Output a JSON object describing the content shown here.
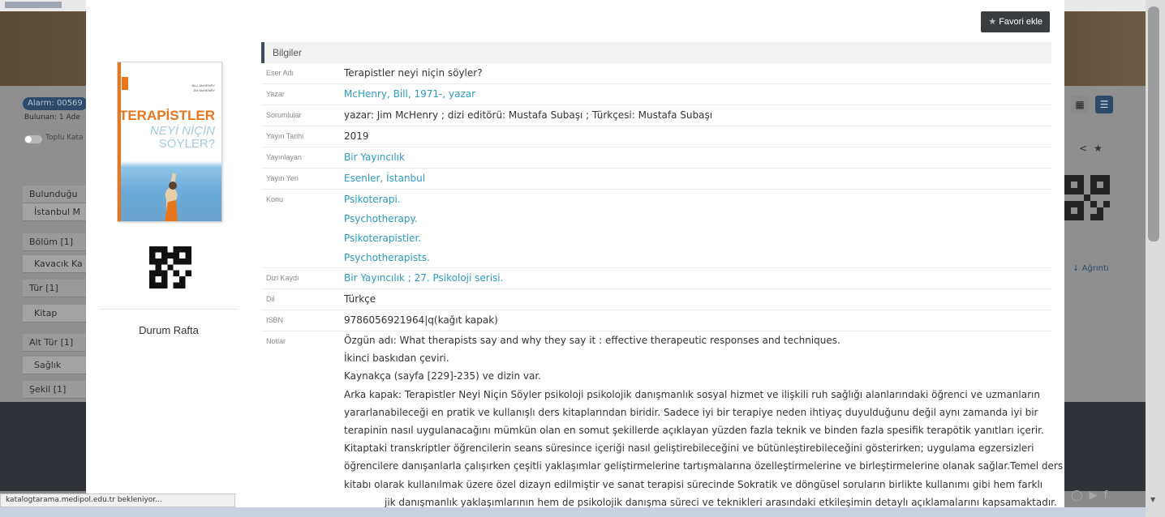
{
  "background": {
    "badge": "Alarm: 00569",
    "found": "Bulunan: 1 Ade",
    "toggle_label": "Toplu Kata",
    "facets": [
      {
        "label": "Bulunduğu",
        "sub": false
      },
      {
        "label": "İstanbul M",
        "sub": true
      },
      {
        "label": "Bölüm [1]",
        "sub": false
      },
      {
        "label": "Kavacık Ka",
        "sub": true
      },
      {
        "label": "Tür [1]",
        "sub": false
      },
      {
        "label": "Kitap",
        "sub": true
      },
      {
        "label": "Alt Tür [1]",
        "sub": false
      },
      {
        "label": "Sağlık",
        "sub": true
      },
      {
        "label": "Şekil [1]",
        "sub": false
      }
    ],
    "download_label": "Ağrıntı",
    "status_text": "katalogtarama.medipol.edu.tr bekleniyor..."
  },
  "modal": {
    "favorite_button": "Favori ekle",
    "section_title": "Bilgiler",
    "cover": {
      "authors_line1": "BILL McHENRY",
      "authors_line2": "JIM McHENRY",
      "title_line1": "TERAPİSTLER",
      "title_line2": "NEYİ NİÇİN",
      "title_line3": "SÖYLER?"
    },
    "status": "Durum Rafta",
    "fields": {
      "eser_adi": {
        "label": "Eser Adı",
        "value": "Terapistler neyi niçin söyler?"
      },
      "yazar": {
        "label": "Yazar",
        "value": "McHenry, Bill, 1971-, yazar"
      },
      "sorumlular": {
        "label": "Sorumlular",
        "value": "yazar: Jim McHenry ; dizi editörü: Mustafa Subaşı ; Türkçesi: Mustafa Subaşı"
      },
      "yayin_tarihi": {
        "label": "Yayın Tarihi",
        "value": "2019"
      },
      "yayinlayan": {
        "label": "Yayınlayan",
        "value": "Bir Yayıncılık"
      },
      "yayin_yeri": {
        "label": "Yayın Yeri",
        "value": "Esenler, İstanbul"
      },
      "konu": {
        "label": "Konu",
        "values": [
          "Psikoterapi.",
          "Psychotherapy.",
          "Psikoterapistler.",
          "Psychotherapists."
        ]
      },
      "dizi_kaydi": {
        "label": "Dizi Kaydı",
        "value": "Bir Yayıncılık ; 27. Psikoloji serisi."
      },
      "dil": {
        "label": "Dil",
        "value": "Türkçe"
      },
      "isbn": {
        "label": "ISBN",
        "value": "9786056921964|q(kağıt kapak)"
      },
      "notlar": {
        "label": "Notlar",
        "lines": [
          "Özgün adı: What therapists say and why they say it : effective therapeutic responses and techniques.",
          "İkinci baskıdan çeviri.",
          "Kaynakça (sayfa [229]-235) ve dizin var.",
          "Arka kapak: Terapistler Neyi Niçin Söyler psikoloji psikolojik danışmanlık sosyal hizmet ve ilişkili ruh sağlığı alanlarındaki öğrenci ve uzmanların",
          "yararlanabileceği en pratik ve kullanışlı ders kitaplarından biridir. Sadece iyi bir terapiye neden ihtiyaç duyulduğunu değil aynı zamanda iyi bir",
          "terapinin nasıl uygulanacağını mümkün olan en somut şekillerde açıklayan yüzden fazla teknik ve binden fazla spesifik terapötik yanıtları içerir.",
          "Kitaptaki transkriptler öğrencilerin seans süresince içeriği nasıl geliştirebileceğini ve bütünleştirebileceğini gösterirken; uygulama egzersizleri",
          "öğrencilere danışanlarla çalışırken çeşitli yaklaşımlar geliştirmelerine tartışmalarına özelleştirmelerine ve birleştirmelerine olanak sağlar.Temel ders",
          "kitabı olarak kullanılmak üzere özel dizayn edilmiştir ve sanat terapisi sürecinde Sokratik ve döngüsel soruların birlikte kullanımı gibi hem farklı",
          "jik danışmanlık yaklaşımlarının hem de psikolojik danışma süreci ve teknikleri arasındaki etkileşimin detaylı açıklamalarını kapsamaktadır."
        ]
      }
    }
  }
}
